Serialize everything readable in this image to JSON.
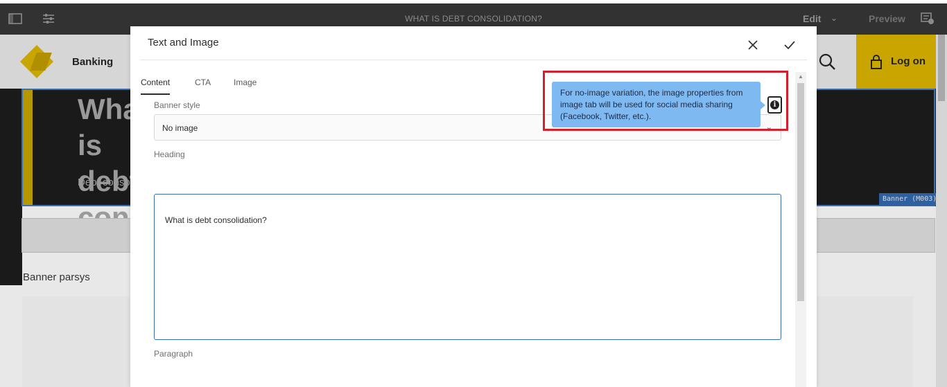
{
  "topbar": {
    "page_title": "WHAT IS DEBT CONSOLIDATION?",
    "edit_label": "Edit",
    "preview_label": "Preview"
  },
  "site": {
    "brand": "Banking",
    "logon_label": "Log on",
    "banner_heading": "What is debt consolidation?",
    "banner_text": "Debt consolidation interest rat",
    "banner_badge": "Banner (M003)",
    "parsys_label": "Banner parsys"
  },
  "dialog": {
    "title": "Text and Image",
    "tabs": [
      {
        "label": "Content",
        "active": true
      },
      {
        "label": "CTA",
        "active": false
      },
      {
        "label": "Image",
        "active": false
      }
    ],
    "banner_style_label": "Banner style",
    "banner_style_value": "No image",
    "heading_label": "Heading",
    "heading_value": "What is debt consolidation?",
    "paragraph_label": "Paragraph",
    "tooltip": "For no-image variation, the image properties from image tab will be used for social media sharing (Facebook, Twitter, etc.)."
  },
  "colors": {
    "accent_blue": "#3a6fb5",
    "tooltip_bg": "#7eb9f2",
    "highlight_red": "#d4202c",
    "brand_yellow": "#c9a500"
  }
}
